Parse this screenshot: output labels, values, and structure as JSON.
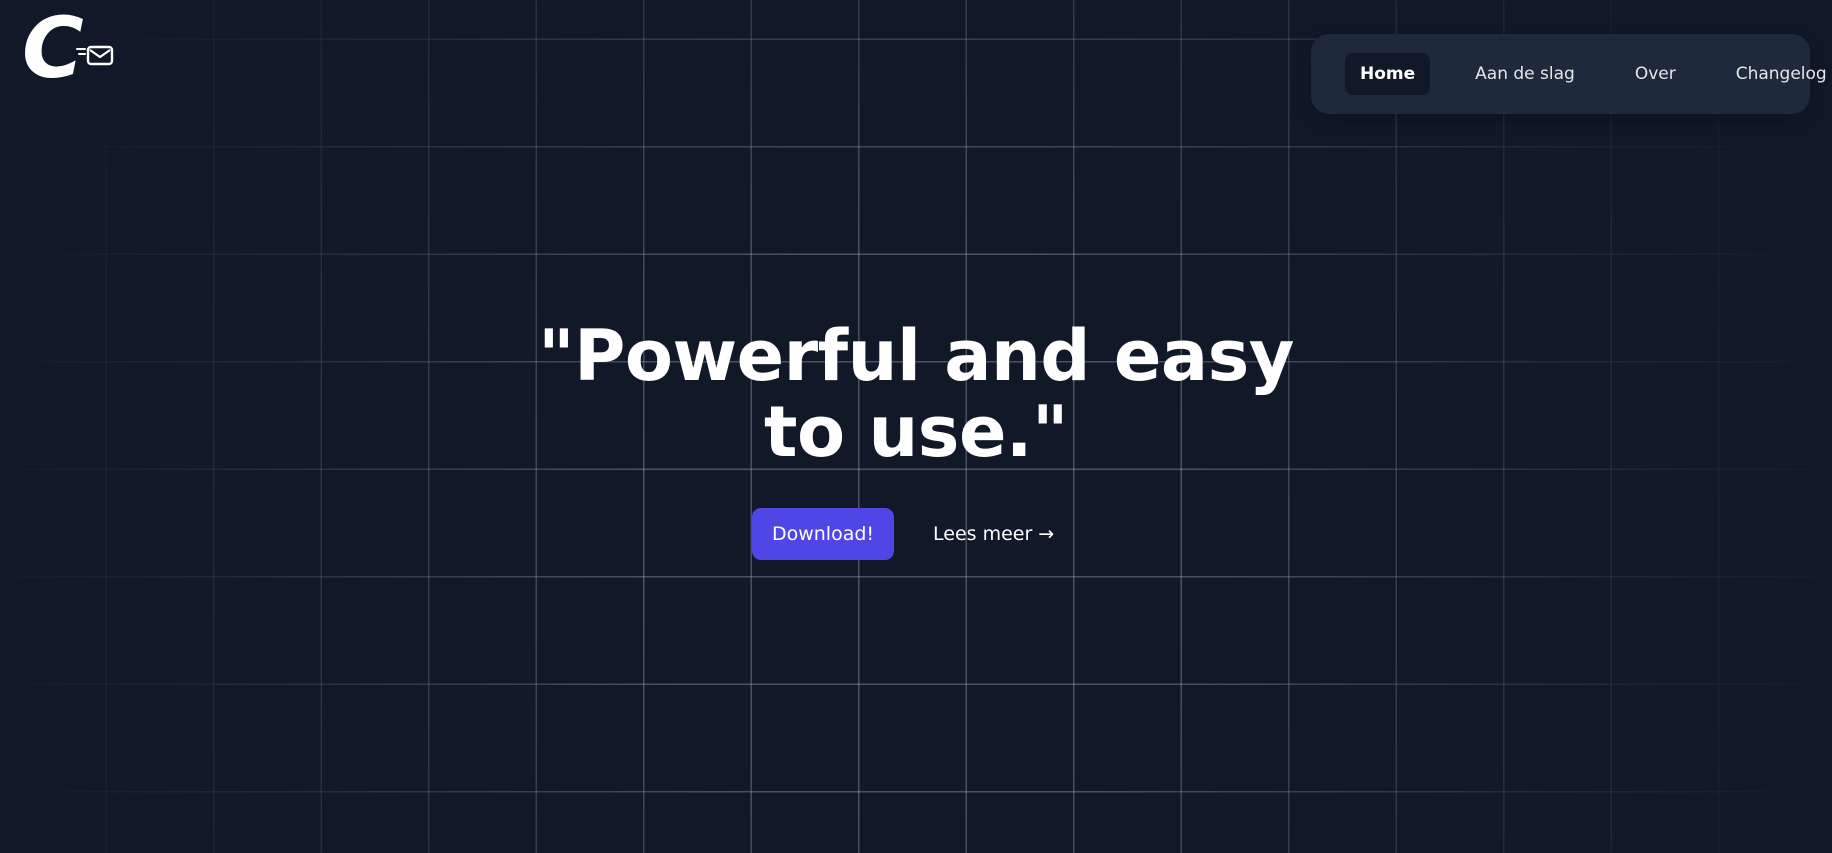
{
  "logo": {
    "letter": "C",
    "icon": "mail-icon"
  },
  "nav": {
    "items": [
      {
        "label": "Home",
        "active": true
      },
      {
        "label": "Aan de slag",
        "active": false
      },
      {
        "label": "Over",
        "active": false
      },
      {
        "label": "Changelog",
        "active": false
      }
    ]
  },
  "hero": {
    "title": "\"Powerful and easy to use.\"",
    "download_label": "Download!",
    "more_label": "Lees meer →"
  },
  "colors": {
    "background": "#111827",
    "nav_background": "#1e293b",
    "active_tab": "#111827",
    "accent": "#4f46e5",
    "text": "#ffffff"
  }
}
